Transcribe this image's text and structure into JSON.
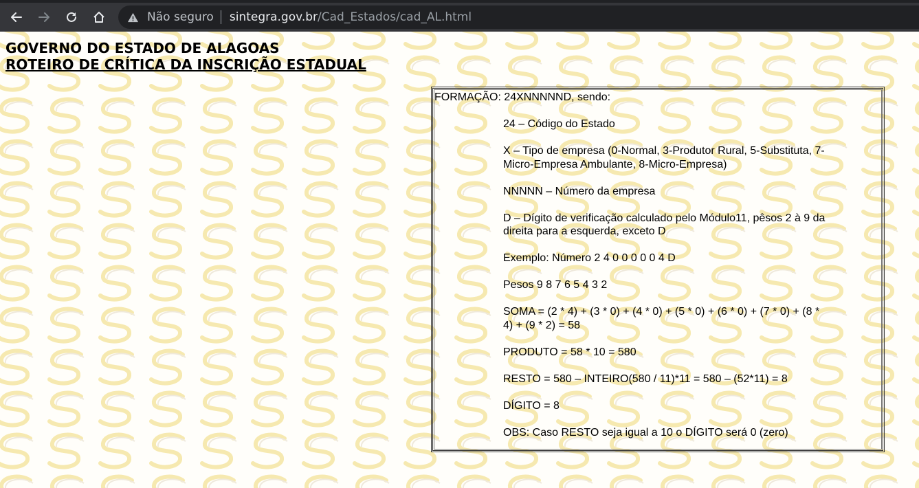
{
  "browser": {
    "security_label": "Não seguro",
    "url_host": "sintegra.gov.br",
    "url_path": "/Cad_Estados/cad_AL.html"
  },
  "page": {
    "title_line1": "GOVERNO DO ESTADO DE ALAGOAS",
    "title_line2": "ROTEIRO DE CRÍTICA DA INSCRIÇÃO ESTADUAL",
    "formacao": "FORMAÇÃO: 24XNNNNND,  sendo:",
    "items": [
      "24 – Código do Estado",
      "X – Tipo de empresa (0-Normal, 3-Produtor Rural, 5-Substituta, 7- Micro-Empresa Ambulante, 8-Micro-Empresa)",
      "NNNNN – Número da empresa",
      "D – Dígito de verificação calculado pelo Módulo11, pêsos 2 à 9 da direita para a esquerda, exceto D",
      "Exemplo: Número 2 4 0 0 0 0 0 4 D",
      "Pesos 9 8 7 6 5 4 3 2",
      "SOMA = (2 * 4) + (3 * 0) + (4 * 0) + (5 * 0) + (6 * 0) + (7 * 0) + (8 * 4) + (9 * 2) = 58",
      "PRODUTO = 58 * 10 = 580",
      "RESTO = 580 – INTEIRO(580 / 11)*11 = 580 – (52*11) = 8",
      "DÍGITO = 8",
      "OBS: Caso RESTO seja igual a 10 o DÍGITO será 0 (zero)"
    ]
  },
  "colors": {
    "chrome_bg": "#35363a",
    "omnibox_bg": "#202124",
    "watermark": "#f5e49a"
  }
}
